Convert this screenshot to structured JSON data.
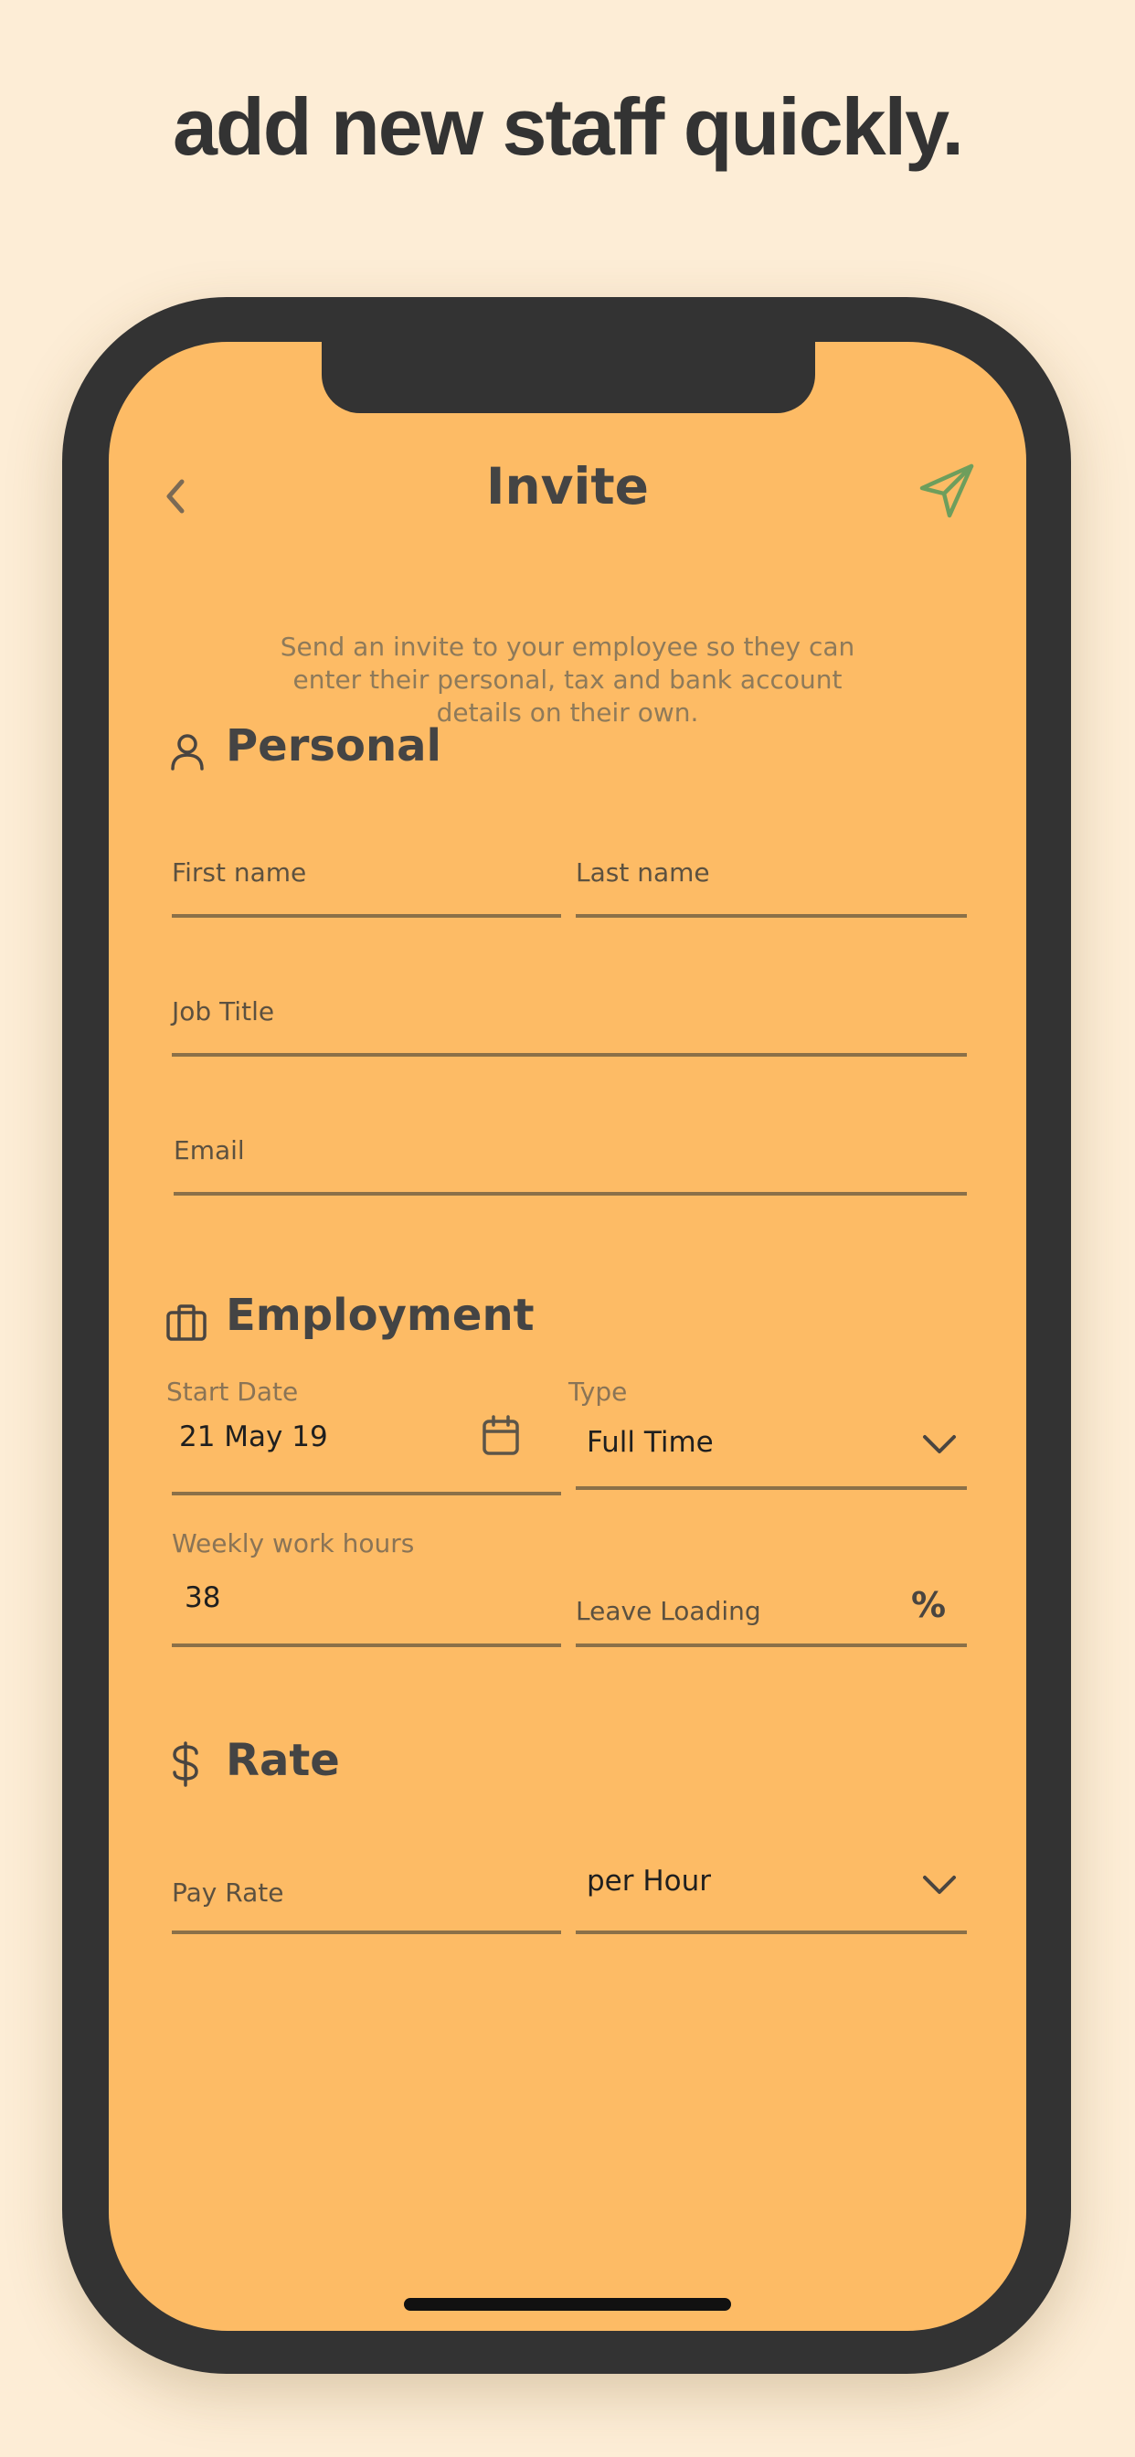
{
  "headline": "add new staff quickly.",
  "nav": {
    "title": "Invite"
  },
  "intro": {
    "line1": "Send an invite to your employee so they can",
    "line2": "enter their personal, tax and bank account",
    "line3": "details on their own."
  },
  "personal": {
    "title": "Personal",
    "icon": "person-icon",
    "first_name_placeholder": "First name",
    "last_name_placeholder": "Last name",
    "job_title_placeholder": "Job Title",
    "email_placeholder": "Email"
  },
  "employment": {
    "title": "Employment",
    "icon": "briefcase-icon",
    "start_date_label": "Start Date",
    "start_date_value": "21 May 19",
    "type_label": "Type",
    "type_value": "Full Time",
    "weekly_hours_label": "Weekly work hours",
    "weekly_hours_value": "38",
    "leave_loading_placeholder": "Leave Loading",
    "percent_symbol": "%"
  },
  "rate": {
    "title": "Rate",
    "icon": "dollar-icon",
    "pay_rate_placeholder": "Pay Rate",
    "period_value": "per Hour"
  },
  "colors": {
    "background": "#FDEDD6",
    "screen": "#FDBB65",
    "frame": "#333333",
    "send_icon": "#6E9E5C",
    "underline": "#8B7048"
  }
}
